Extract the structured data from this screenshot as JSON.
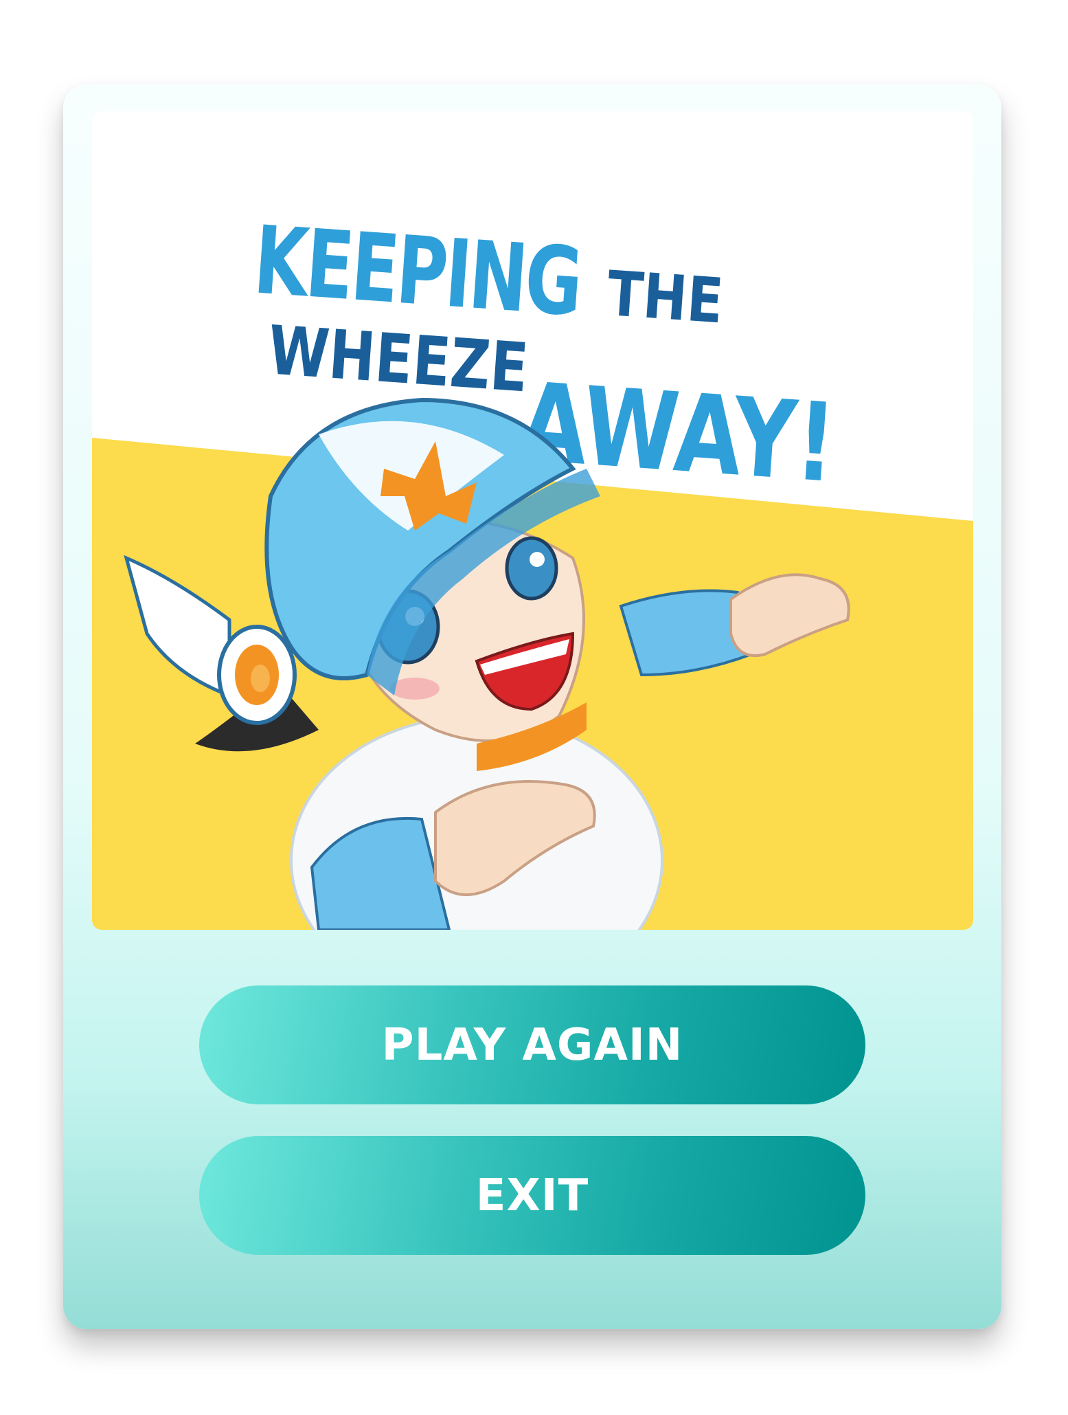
{
  "title": {
    "line1_big": "KEEPING",
    "line1_small": "THE",
    "line2_small": "WHEEZE",
    "line2_big": "AWAY!"
  },
  "buttons": {
    "play_again": "PLAY AGAIN",
    "exit": "EXIT"
  },
  "colors": {
    "title_light_blue": "#2f9fd9",
    "title_dark_blue": "#1a5f9a",
    "banner_yellow": "#fcdb4c",
    "button_start": "#6fe8dc",
    "button_end": "#00938f"
  },
  "icons": {
    "mascot": "mascot-character-helmet",
    "helmet_logo": "m-logo"
  }
}
